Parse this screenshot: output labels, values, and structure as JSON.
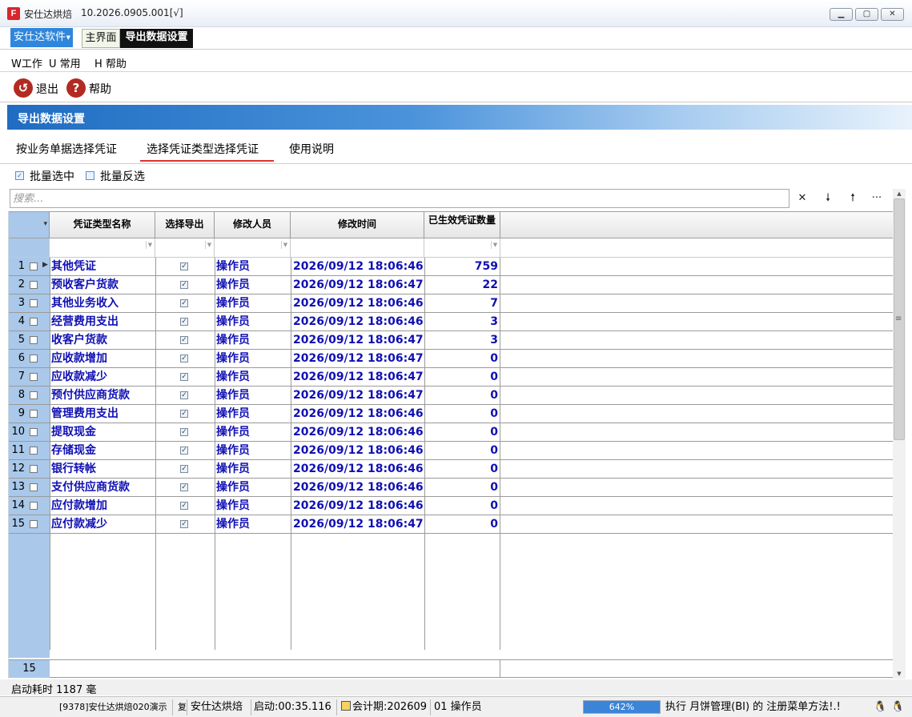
{
  "window": {
    "title": "安仕达烘焙",
    "version": "10.2026.0905.001[√]",
    "logo_letter": "F"
  },
  "module_bar": {
    "brand": "安仕达软件",
    "tabs": [
      {
        "label": "主界面",
        "active": false
      },
      {
        "label": "导出数据设置",
        "active": true
      }
    ]
  },
  "menu": {
    "items": [
      {
        "label": "W工作"
      },
      {
        "label": "U 常用"
      },
      {
        "label": "H 帮助"
      }
    ]
  },
  "toolbar": {
    "exit_label": "退出",
    "help_label": "帮助"
  },
  "page": {
    "title": "导出数据设置"
  },
  "subtabs": [
    {
      "label": "按业务单据选择凭证",
      "active": false
    },
    {
      "label": "选择凭证类型选择凭证",
      "active": true
    },
    {
      "label": "使用说明",
      "active": false
    }
  ],
  "batch": {
    "select_label": "批量选中",
    "invert_label": "批量反选"
  },
  "search": {
    "placeholder": "搜索..."
  },
  "grid": {
    "columns": [
      "凭证类型名称",
      "选择导出",
      "修改人员",
      "修改时间",
      "已生效凭证数量"
    ],
    "rows": [
      {
        "no": "1",
        "name": "其他凭证",
        "export": true,
        "user": "操作员",
        "time": "2026/09/12 18:06:46",
        "count": "759"
      },
      {
        "no": "2",
        "name": "预收客户货款",
        "export": true,
        "user": "操作员",
        "time": "2026/09/12 18:06:47",
        "count": "22"
      },
      {
        "no": "3",
        "name": "其他业务收入",
        "export": true,
        "user": "操作员",
        "time": "2026/09/12 18:06:46",
        "count": "7"
      },
      {
        "no": "4",
        "name": "经营费用支出",
        "export": true,
        "user": "操作员",
        "time": "2026/09/12 18:06:46",
        "count": "3"
      },
      {
        "no": "5",
        "name": "收客户货款",
        "export": true,
        "user": "操作员",
        "time": "2026/09/12 18:06:47",
        "count": "3"
      },
      {
        "no": "6",
        "name": "应收款增加",
        "export": true,
        "user": "操作员",
        "time": "2026/09/12 18:06:47",
        "count": "0"
      },
      {
        "no": "7",
        "name": "应收款减少",
        "export": true,
        "user": "操作员",
        "time": "2026/09/12 18:06:47",
        "count": "0"
      },
      {
        "no": "8",
        "name": "预付供应商货款",
        "export": true,
        "user": "操作员",
        "time": "2026/09/12 18:06:47",
        "count": "0"
      },
      {
        "no": "9",
        "name": "管理费用支出",
        "export": true,
        "user": "操作员",
        "time": "2026/09/12 18:06:46",
        "count": "0"
      },
      {
        "no": "10",
        "name": "提取现金",
        "export": true,
        "user": "操作员",
        "time": "2026/09/12 18:06:46",
        "count": "0"
      },
      {
        "no": "11",
        "name": "存储现金",
        "export": true,
        "user": "操作员",
        "time": "2026/09/12 18:06:46",
        "count": "0"
      },
      {
        "no": "12",
        "name": "银行转帐",
        "export": true,
        "user": "操作员",
        "time": "2026/09/12 18:06:46",
        "count": "0"
      },
      {
        "no": "13",
        "name": "支付供应商货款",
        "export": true,
        "user": "操作员",
        "time": "2026/09/12 18:06:46",
        "count": "0"
      },
      {
        "no": "14",
        "name": "应付款增加",
        "export": true,
        "user": "操作员",
        "time": "2026/09/12 18:06:46",
        "count": "0"
      },
      {
        "no": "15",
        "name": "应付款减少",
        "export": true,
        "user": "操作员",
        "time": "2026/09/12 18:06:47",
        "count": "0"
      }
    ],
    "footer_count": "15"
  },
  "status": {
    "startup_time": "启动耗时  1187  毫",
    "segments": {
      "company": "[9378]安仕达烘焙020演示",
      "marker": "复",
      "app": "安仕达烘焙",
      "uptime": "启动:00:35.116",
      "period": "会计期:202609",
      "operator": "01 操作员",
      "progress_text": "642%",
      "message": "执行 月饼管理(BI) 的 注册菜单方法!.!"
    },
    "progress_fraction": 1.0,
    "accent_color": "#3b84d8"
  }
}
